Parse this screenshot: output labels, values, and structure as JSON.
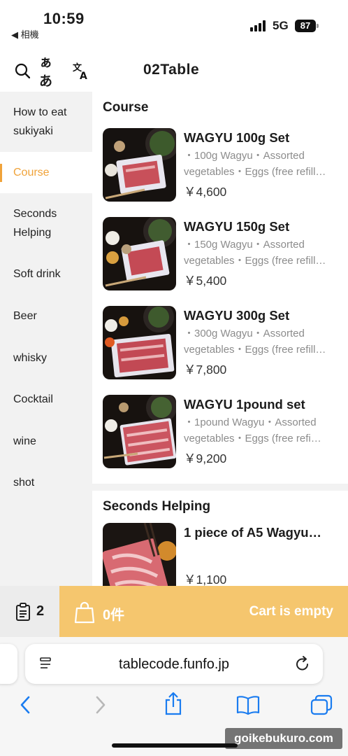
{
  "status": {
    "time": "10:59",
    "back_label": "◀ 相機",
    "network": "5G",
    "battery": "87"
  },
  "header": {
    "title": "02Table",
    "lang_label": "ぁあ"
  },
  "sidebar": {
    "items": [
      {
        "label": "How to eat sukiyaki",
        "active": false
      },
      {
        "label": "Course",
        "active": true
      },
      {
        "label": "Seconds Helping",
        "active": false
      },
      {
        "label": "Soft drink",
        "active": false
      },
      {
        "label": "Beer",
        "active": false
      },
      {
        "label": "whisky",
        "active": false
      },
      {
        "label": "Cocktail",
        "active": false
      },
      {
        "label": "wine",
        "active": false
      },
      {
        "label": "shot",
        "active": false
      }
    ]
  },
  "sections": [
    {
      "title": "Course",
      "items": [
        {
          "name": "WAGYU 100g Set",
          "desc": "・100g Wagyu・Assorted vegetables・Eggs (free refill…",
          "price": "￥4,600"
        },
        {
          "name": "WAGYU 150g Set",
          "desc": "・150g Wagyu・Assorted vegetables・Eggs (free refill…",
          "price": "￥5,400"
        },
        {
          "name": "WAGYU 300g Set",
          "desc": "・300g Wagyu・Assorted vegetables・Eggs (free refill…",
          "price": "￥7,800"
        },
        {
          "name": "WAGYU 1pound set",
          "desc": "・1pound Wagyu・Assorted vegetables・Eggs (free refi…",
          "price": "￥9,200"
        }
      ]
    },
    {
      "title": "Seconds Helping",
      "items": [
        {
          "name": "1 piece of A5 Wagyu…",
          "desc": "",
          "price": "￥1,100"
        }
      ]
    }
  ],
  "cart": {
    "orders_count": "2",
    "item_count": "0件",
    "empty_label": "Cart is empty"
  },
  "browser": {
    "url": "tablecode.funfo.jp"
  },
  "watermark": "goikebukuro.com",
  "colors": {
    "accent": "#f0a33a",
    "cart_bar": "#f5c66e",
    "ios_blue": "#1a7cf0"
  }
}
